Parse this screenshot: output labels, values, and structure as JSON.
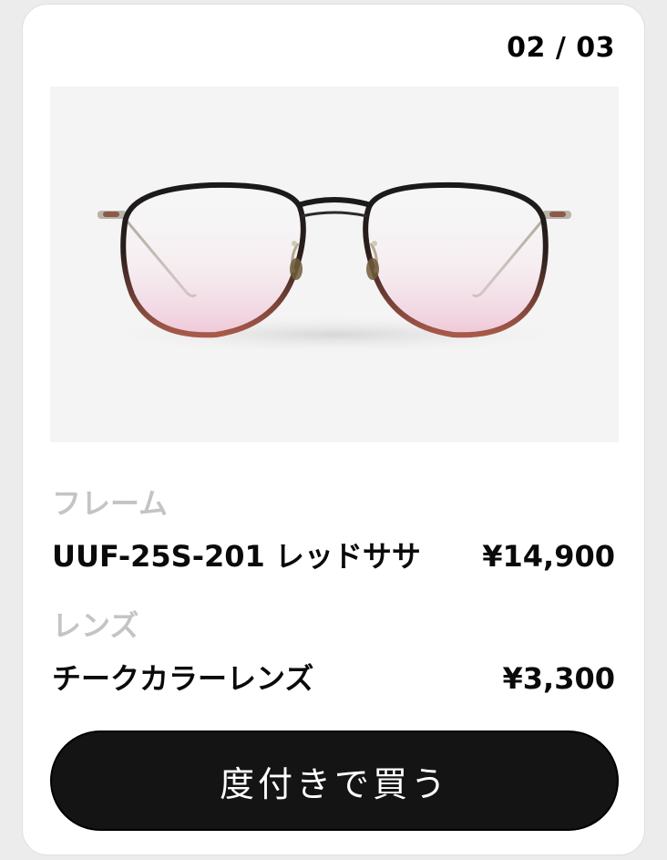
{
  "carousel": {
    "counter": "02 / 03"
  },
  "product": {
    "image_alt": "round metal eyeglasses with black-to-red gradient rims and pink-tinted lenses"
  },
  "frame": {
    "label": "フレーム",
    "name": "UUF-25S-201 レッドササ",
    "price": "¥14,900"
  },
  "lens": {
    "label": "レンズ",
    "name": "チークカラーレンズ",
    "price": "¥3,300"
  },
  "action": {
    "buy_label": "度付きで買う"
  },
  "colors": {
    "background": "#ececec",
    "card": "#ffffff",
    "label_gray": "#c4c4c4",
    "button": "#141414"
  }
}
